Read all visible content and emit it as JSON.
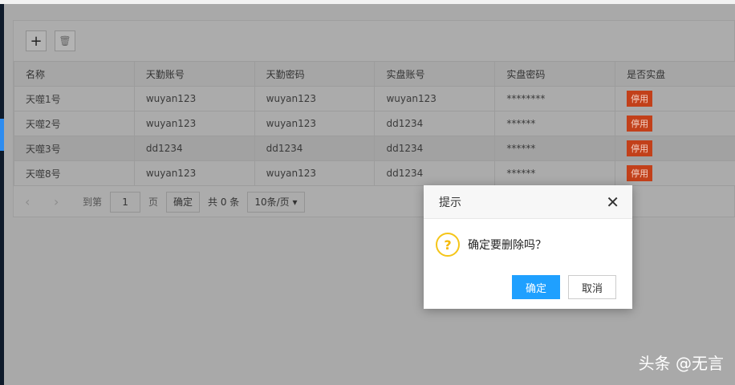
{
  "toolbar": {
    "add_icon": "+",
    "delete_icon": "🗑"
  },
  "table": {
    "headers": [
      "名称",
      "天勤账号",
      "天勤密码",
      "实盘账号",
      "实盘密码",
      "是否实盘"
    ],
    "rows": [
      [
        "天噬1号",
        "wuyan123",
        "wuyan123",
        "wuyan123",
        "********",
        "停用"
      ],
      [
        "天噬2号",
        "wuyan123",
        "wuyan123",
        "dd1234",
        "******",
        "停用"
      ],
      [
        "天噬3号",
        "dd1234",
        "dd1234",
        "dd1234",
        "******",
        "停用"
      ],
      [
        "天噬8号",
        "wuyan123",
        "wuyan123",
        "dd1234",
        "******",
        "停用"
      ]
    ]
  },
  "pager": {
    "prev": "‹",
    "next": "›",
    "goto_label": "到第",
    "page_value": "1",
    "page_suffix": "页",
    "confirm": "确定",
    "total": "共 0 条",
    "page_size": "10条/页",
    "dropdown": "▾"
  },
  "dialog": {
    "title": "提示",
    "close": "✕",
    "icon": "?",
    "message": "确定要删除吗？",
    "ok": "确定",
    "cancel": "取消"
  },
  "watermark": "头条 @无言",
  "colors": {
    "badge": "#c2401a",
    "primary": "#1fa0ff",
    "warning": "#f5c518"
  }
}
